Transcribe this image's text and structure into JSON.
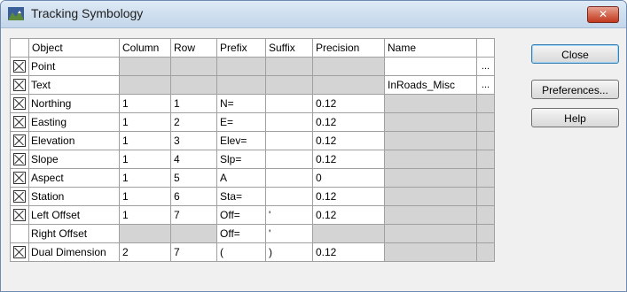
{
  "window": {
    "title": "Tracking Symbology",
    "close_glyph": "✕"
  },
  "columns": [
    "Object",
    "Column",
    "Row",
    "Prefix",
    "Suffix",
    "Precision",
    "Name"
  ],
  "rows": [
    {
      "checked": true,
      "object": "Point",
      "column": "",
      "row": "",
      "prefix": "",
      "suffix": "",
      "precision": "",
      "name": "",
      "ellipsis": "...",
      "type": "name"
    },
    {
      "checked": true,
      "object": "Text",
      "column": "",
      "row": "",
      "prefix": "",
      "suffix": "",
      "precision": "",
      "name": "InRoads_Misc",
      "ellipsis": "...",
      "type": "name"
    },
    {
      "checked": true,
      "object": "Northing",
      "column": "1",
      "row": "1",
      "prefix": "N=",
      "suffix": "",
      "precision": "0.12",
      "name": "",
      "ellipsis": "",
      "type": "data"
    },
    {
      "checked": true,
      "object": "Easting",
      "column": "1",
      "row": "2",
      "prefix": "E=",
      "suffix": "",
      "precision": "0.12",
      "name": "",
      "ellipsis": "",
      "type": "data"
    },
    {
      "checked": true,
      "object": "Elevation",
      "column": "1",
      "row": "3",
      "prefix": "Elev=",
      "suffix": "",
      "precision": "0.12",
      "name": "",
      "ellipsis": "",
      "type": "data"
    },
    {
      "checked": true,
      "object": "Slope",
      "column": "1",
      "row": "4",
      "prefix": "Slp=",
      "suffix": "",
      "precision": "0.12",
      "name": "",
      "ellipsis": "",
      "type": "data"
    },
    {
      "checked": true,
      "object": "Aspect",
      "column": "1",
      "row": "5",
      "prefix": "A",
      "suffix": "",
      "precision": "0",
      "name": "",
      "ellipsis": "",
      "type": "data"
    },
    {
      "checked": true,
      "object": "Station",
      "column": "1",
      "row": "6",
      "prefix": "Sta=",
      "suffix": "",
      "precision": "0.12",
      "name": "",
      "ellipsis": "",
      "type": "data"
    },
    {
      "checked": true,
      "object": "Left Offset",
      "column": "1",
      "row": "7",
      "prefix": "Off=",
      "suffix": "'",
      "precision": "0.12",
      "name": "",
      "ellipsis": "",
      "type": "data"
    },
    {
      "checked": false,
      "object": "Right Offset",
      "column": "",
      "row": "",
      "prefix": "Off=",
      "suffix": "'",
      "precision": "",
      "name": "",
      "ellipsis": "",
      "type": "disabled"
    },
    {
      "checked": true,
      "object": "Dual Dimension",
      "column": "2",
      "row": "7",
      "prefix": "(",
      "suffix": ")",
      "precision": "0.12",
      "name": "",
      "ellipsis": "",
      "type": "data"
    }
  ],
  "buttons": {
    "close": "Close",
    "preferences": "Preferences...",
    "help": "Help"
  }
}
